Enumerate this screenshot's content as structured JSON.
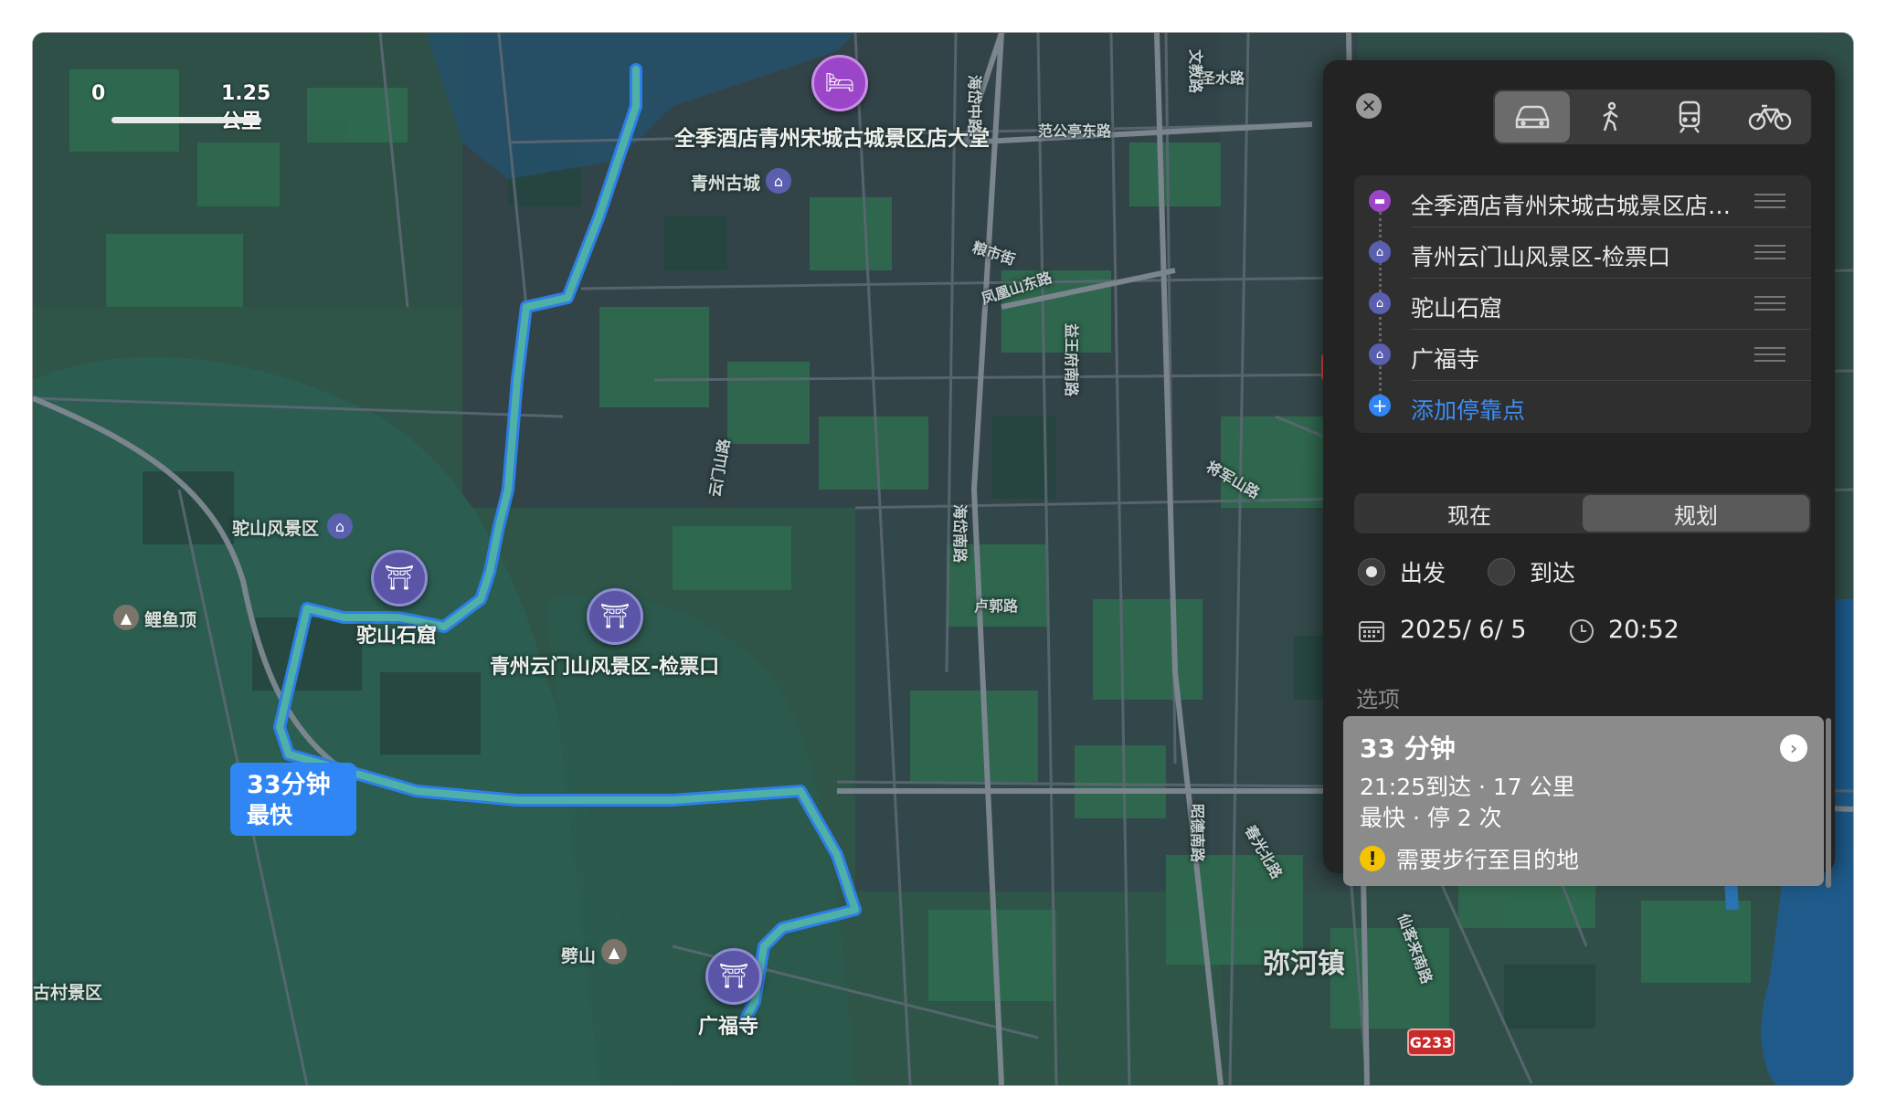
{
  "map": {
    "scale": {
      "zero": "0",
      "distance": "1.25 公里"
    },
    "places": {
      "hotel": "全季酒店青州宋城古城景区店大堂",
      "qingzhou_old_city": "青州古城",
      "tuoshan_scenic": "驼山风景区",
      "tuoshan_grotto": "驼山石窟",
      "yunmen_gate": "青州云门山风景区-检票口",
      "liyu_peak": "鲤鱼顶",
      "pishan": "劈山",
      "guangfu_temple": "广福寺",
      "village_scenic": "古村景区",
      "mihe_town": "弥河镇"
    },
    "roads": {
      "fanxiting_e": "范公亭东路",
      "liangshi": "粮市街",
      "fenghuangshan_e": "凤凰山东路",
      "yiwangfu_s": "益王府南路",
      "haidai_middle": "海岱中路",
      "haidai_s": "海岱南路",
      "lugu": "卢郭路",
      "jiangjunshan": "将军山路",
      "yunmenshan": "云门山路",
      "shengshui": "圣水路",
      "chunhui_n": "春光北路",
      "zhaode_s": "昭德南路",
      "xiancun_s": "仙客来南路",
      "wenjiao": "文教路",
      "g233": "G233"
    },
    "route_badge": {
      "time": "33分钟",
      "label": "最快"
    },
    "colors": {
      "route": "#4fb0d0",
      "route_outline": "#2d7ee8",
      "poi": "#5b55a8",
      "hotel_poi": "#9b45c8"
    }
  },
  "panel": {
    "close_icon": "close-icon",
    "modes": [
      {
        "name": "car",
        "selected": true
      },
      {
        "name": "walk",
        "selected": false
      },
      {
        "name": "transit",
        "selected": false
      },
      {
        "name": "bike",
        "selected": false
      }
    ],
    "stops": [
      {
        "label": "全季酒店青州宋城古城景区店…",
        "icon": "bed-icon",
        "color": "#9b45c8"
      },
      {
        "label": "青州云门山风景区-检票口",
        "icon": "landmark-icon",
        "color": "#5b5fb0"
      },
      {
        "label": "驼山石窟",
        "icon": "landmark-icon",
        "color": "#5b5fb0"
      },
      {
        "label": "广福寺",
        "icon": "temple-icon",
        "color": "#5b5fb0"
      }
    ],
    "add_stop": "添加停靠点",
    "segment": {
      "now": "现在",
      "plan": "规划",
      "selected": "plan"
    },
    "depart": "出发",
    "arrive": "到达",
    "date": "2025/  6/  5",
    "time": "20:52",
    "options_label": "选项",
    "route_option": {
      "duration": "33 分钟",
      "arrival": "21:25到达 · 17 公里",
      "summary": "最快 · 停 2 次",
      "warning": "需要步行至目的地"
    }
  }
}
